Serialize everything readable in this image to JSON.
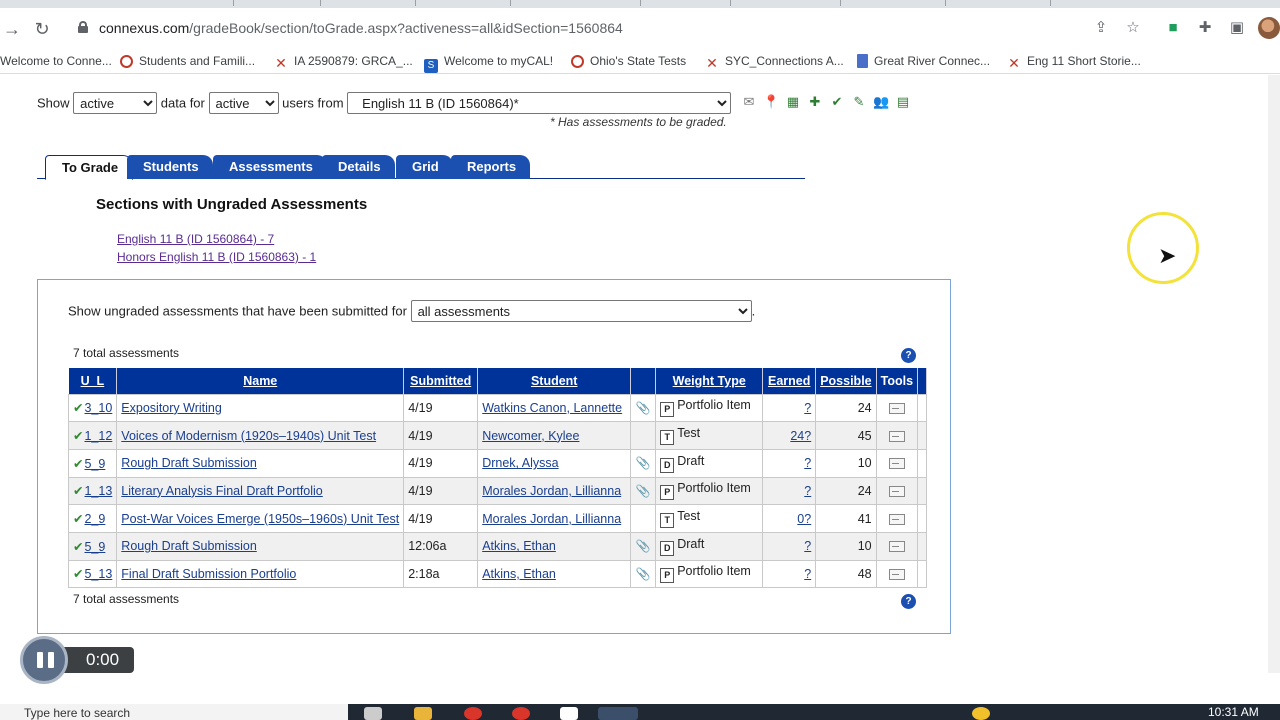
{
  "browser": {
    "url_host": "connexus.com",
    "url_path": "/gradeBook/section/toGrade.aspx?activeness=all&idSection=1560864"
  },
  "bookmarks": [
    {
      "label": "Welcome to Conne...",
      "icon": "none"
    },
    {
      "label": "Students and Famili...",
      "icon": "circle-icon"
    },
    {
      "label": "IA 2590879: GRCA_...",
      "icon": "connexus-x-icon"
    },
    {
      "label": "Welcome to myCAL!",
      "icon": "s-icon"
    },
    {
      "label": "Ohio's State Tests",
      "icon": "circle-icon"
    },
    {
      "label": "SYC_Connections A...",
      "icon": "connexus-x-icon"
    },
    {
      "label": "Great River Connec...",
      "icon": "doc-icon"
    },
    {
      "label": "Eng 11 Short Storie...",
      "icon": "connexus-x-icon"
    }
  ],
  "filters": {
    "show_label": "Show",
    "show_value": "active",
    "data_for_label": "data for",
    "users_value": "active",
    "users_from_label": "users from",
    "section_value": "English 11 B (ID 1560864)*",
    "note": "* Has assessments to be graded."
  },
  "tabs": [
    "To Grade",
    "Students",
    "Assessments",
    "Details",
    "Grid",
    "Reports"
  ],
  "sections_heading": "Sections with Ungraded Assessments",
  "section_links": [
    "English 11 B (ID 1560864) - 7",
    "Honors English 11 B (ID 1560863) - 1"
  ],
  "panel": {
    "filter_label": "Show ungraded assessments that have been submitted for",
    "filter_value": "all assessments",
    "total_top": "7 total assessments",
    "total_bottom": "7 total assessments",
    "help": "?"
  },
  "columns": [
    "U_L",
    "Name",
    "Submitted",
    "Student",
    "",
    "Weight Type",
    "Earned",
    "Possible",
    "Tools"
  ],
  "rows": [
    {
      "ul": "3_10",
      "name": "Expository Writing",
      "submitted": "4/19",
      "student": "Watkins Canon, Lannette",
      "visited": false,
      "attach": true,
      "wt_icon": "P",
      "weight": "Portfolio Item",
      "earned": "?",
      "possible": "24"
    },
    {
      "ul": "1_12",
      "name": "Voices of Modernism (1920s–1940s) Unit Test",
      "submitted": "4/19",
      "student": "Newcomer, Kylee",
      "visited": false,
      "attach": false,
      "wt_icon": "T",
      "weight": "Test",
      "earned": "24?",
      "possible": "45"
    },
    {
      "ul": "5_9",
      "name": "Rough Draft Submission",
      "submitted": "4/19",
      "student": "Drnek, Alyssa",
      "visited": false,
      "attach": true,
      "wt_icon": "D",
      "weight": "Draft",
      "earned": "?",
      "possible": "10"
    },
    {
      "ul": "1_13",
      "name": "Literary Analysis Final Draft Portfolio",
      "submitted": "4/19",
      "student": "Morales Jordan, Lillianna",
      "visited": false,
      "attach": true,
      "wt_icon": "P",
      "weight": "Portfolio Item",
      "earned": "?",
      "possible": "24"
    },
    {
      "ul": "2_9",
      "name": "Post-War Voices Emerge (1950s–1960s) Unit Test",
      "submitted": "4/19",
      "student": "Morales Jordan, Lillianna",
      "visited": false,
      "attach": false,
      "wt_icon": "T",
      "weight": "Test",
      "earned": "0?",
      "possible": "41"
    },
    {
      "ul": "5_9",
      "name": "Rough Draft Submission",
      "submitted": "12:06a",
      "student": "Atkins, Ethan",
      "visited": true,
      "attach": true,
      "wt_icon": "D",
      "weight": "Draft",
      "earned": "?",
      "possible": "10"
    },
    {
      "ul": "5_13",
      "name": "Final Draft Submission Portfolio",
      "submitted": "2:18a",
      "student": "Atkins, Ethan",
      "visited": true,
      "attach": true,
      "wt_icon": "P",
      "weight": "Portfolio Item",
      "earned": "?",
      "possible": "48"
    }
  ],
  "recorder": {
    "time": "0:00"
  },
  "taskbar": {
    "search_label": "Type here to search",
    "clock": "10:31 AM"
  }
}
